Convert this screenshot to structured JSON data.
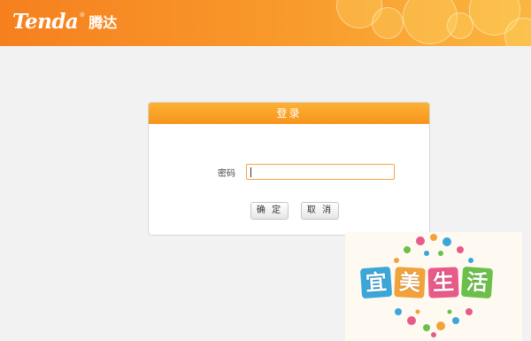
{
  "header": {
    "logo_en": "Tenda",
    "logo_reg": "®",
    "logo_cn": "腾达",
    "bg_color": "#f7891f"
  },
  "login": {
    "title": "登录",
    "password_label": "密码",
    "password_value": "",
    "ok_label": "确 定",
    "cancel_label": "取 消",
    "accent_color": "#f7941d"
  },
  "watermark": {
    "chars": [
      "宜",
      "美",
      "生",
      "活"
    ],
    "char_colors": [
      "#3aa7d8",
      "#f2a23a",
      "#e85a8a",
      "#6cc04a"
    ]
  }
}
